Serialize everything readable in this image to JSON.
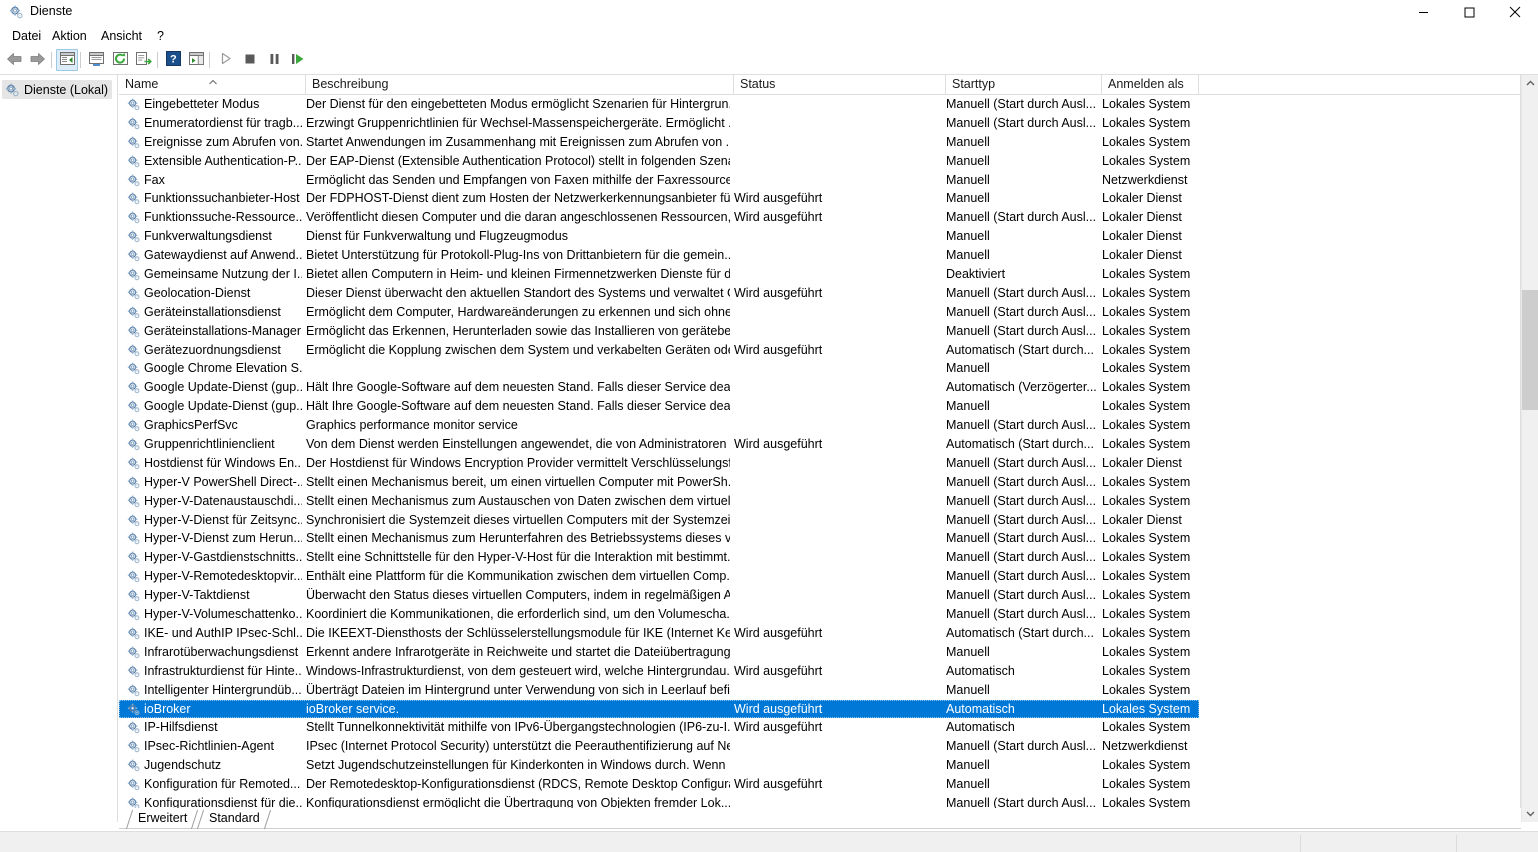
{
  "window": {
    "title": "Dienste",
    "icon": "services-gear-icon",
    "controls": {
      "minimize": "minimize-icon",
      "maximize": "maximize-icon",
      "close": "close-icon"
    }
  },
  "menubar": {
    "items": [
      {
        "label": "Datei"
      },
      {
        "label": "Aktion"
      },
      {
        "label": "Ansicht"
      },
      {
        "label": "?"
      }
    ]
  },
  "toolbar": {
    "buttons": [
      {
        "name": "back-button",
        "icon": "arrow-left-icon"
      },
      {
        "name": "forward-button",
        "icon": "arrow-right-icon"
      },
      {
        "name": "show-hide-console-tree-button",
        "icon": "console-tree-icon",
        "active": true
      },
      {
        "name": "properties-button",
        "icon": "properties-window-icon"
      },
      {
        "name": "refresh-button",
        "icon": "refresh-circular-arrow-icon"
      },
      {
        "name": "export-list-button",
        "icon": "export-list-icon"
      },
      {
        "name": "help-button",
        "icon": "help-question-icon"
      },
      {
        "name": "show-action-pane-button",
        "icon": "action-pane-icon"
      },
      {
        "name": "start-service-button",
        "icon": "play-triangle-icon"
      },
      {
        "name": "stop-service-button",
        "icon": "stop-square-icon"
      },
      {
        "name": "pause-service-button",
        "icon": "pause-bars-icon"
      },
      {
        "name": "restart-service-button",
        "icon": "restart-play-icon"
      }
    ]
  },
  "tree": {
    "root": {
      "label": "Dienste (Lokal)",
      "icon": "services-gear-icon",
      "selected": true
    }
  },
  "list": {
    "columns": [
      {
        "key": "name",
        "label": "Name",
        "sorted": "asc"
      },
      {
        "key": "description",
        "label": "Beschreibung"
      },
      {
        "key": "status",
        "label": "Status"
      },
      {
        "key": "starttype",
        "label": "Starttyp"
      },
      {
        "key": "logon",
        "label": "Anmelden als"
      }
    ],
    "rows": [
      {
        "name": "Eingebetteter Modus",
        "description": "Der Dienst für den eingebetteten Modus ermöglicht Szenarien für Hintergrun...",
        "status": "",
        "starttype": "Manuell (Start durch Ausl...",
        "logon": "Lokales System"
      },
      {
        "name": "Enumeratordienst für tragb...",
        "description": "Erzwingt Gruppenrichtlinien für Wechsel-Massenspeichergeräte. Ermöglicht ...",
        "status": "",
        "starttype": "Manuell (Start durch Ausl...",
        "logon": "Lokales System"
      },
      {
        "name": "Ereignisse zum Abrufen von...",
        "description": "Startet Anwendungen im Zusammenhang mit Ereignissen zum Abrufen von ...",
        "status": "",
        "starttype": "Manuell",
        "logon": "Lokales System"
      },
      {
        "name": "Extensible Authentication-P...",
        "description": "Der EAP-Dienst (Extensible Authentication Protocol) stellt in folgenden Szenar...",
        "status": "",
        "starttype": "Manuell",
        "logon": "Lokales System"
      },
      {
        "name": "Fax",
        "description": "Ermöglicht das Senden und Empfangen von Faxen mithilfe der Faxressourcen...",
        "status": "",
        "starttype": "Manuell",
        "logon": "Netzwerkdienst"
      },
      {
        "name": "Funktionssuchanbieter-Host",
        "description": "Der FDPHOST-Dienst dient zum Hosten der Netzwerkerkennungsanbieter für ...",
        "status": "Wird ausgeführt",
        "starttype": "Manuell",
        "logon": "Lokaler Dienst"
      },
      {
        "name": "Funktionssuche-Ressource...",
        "description": "Veröffentlicht diesen Computer und die daran angeschlossenen Ressourcen, ...",
        "status": "Wird ausgeführt",
        "starttype": "Manuell (Start durch Ausl...",
        "logon": "Lokaler Dienst"
      },
      {
        "name": "Funkverwaltungsdienst",
        "description": "Dienst für Funkverwaltung und Flugzeugmodus",
        "status": "",
        "starttype": "Manuell",
        "logon": "Lokaler Dienst"
      },
      {
        "name": "Gatewaydienst auf Anwend...",
        "description": "Bietet Unterstützung für Protokoll-Plug-Ins von Drittanbietern für die gemein...",
        "status": "",
        "starttype": "Manuell",
        "logon": "Lokaler Dienst"
      },
      {
        "name": "Gemeinsame Nutzung der I...",
        "description": "Bietet allen Computern in Heim- und kleinen Firmennetzwerken Dienste für d...",
        "status": "",
        "starttype": "Deaktiviert",
        "logon": "Lokales System"
      },
      {
        "name": "Geolocation-Dienst",
        "description": "Dieser Dienst überwacht den aktuellen Standort des Systems und verwaltet Ge...",
        "status": "Wird ausgeführt",
        "starttype": "Manuell (Start durch Ausl...",
        "logon": "Lokales System"
      },
      {
        "name": "Geräteinstallationsdienst",
        "description": "Ermöglicht dem Computer, Hardwareänderungen zu erkennen und sich ohne...",
        "status": "",
        "starttype": "Manuell (Start durch Ausl...",
        "logon": "Lokales System"
      },
      {
        "name": "Geräteinstallations-Manager",
        "description": "Ermöglicht das Erkennen, Herunterladen sowie das Installieren von gerätebez...",
        "status": "",
        "starttype": "Manuell (Start durch Ausl...",
        "logon": "Lokales System"
      },
      {
        "name": "Gerätezuordnungsdienst",
        "description": "Ermöglicht die Kopplung zwischen dem System und verkabelten Geräten ode...",
        "status": "Wird ausgeführt",
        "starttype": "Automatisch (Start durch...",
        "logon": "Lokales System"
      },
      {
        "name": "Google Chrome Elevation S...",
        "description": "",
        "status": "",
        "starttype": "Manuell",
        "logon": "Lokales System"
      },
      {
        "name": "Google Update-Dienst (gup...",
        "description": "Hält Ihre Google-Software auf dem neuesten Stand. Falls dieser Service deakti...",
        "status": "",
        "starttype": "Automatisch (Verzögerter...",
        "logon": "Lokales System"
      },
      {
        "name": "Google Update-Dienst (gup...",
        "description": "Hält Ihre Google-Software auf dem neuesten Stand. Falls dieser Service deakti...",
        "status": "",
        "starttype": "Manuell",
        "logon": "Lokales System"
      },
      {
        "name": "GraphicsPerfSvc",
        "description": "Graphics performance monitor service",
        "status": "",
        "starttype": "Manuell (Start durch Ausl...",
        "logon": "Lokales System"
      },
      {
        "name": "Gruppenrichtlinienclient",
        "description": "Von dem Dienst werden Einstellungen angewendet, die von Administratoren ...",
        "status": "Wird ausgeführt",
        "starttype": "Automatisch (Start durch...",
        "logon": "Lokales System"
      },
      {
        "name": "Hostdienst für Windows En...",
        "description": "Der Hostdienst für Windows Encryption Provider vermittelt Verschlüsselungsf...",
        "status": "",
        "starttype": "Manuell (Start durch Ausl...",
        "logon": "Lokaler Dienst"
      },
      {
        "name": "Hyper-V PowerShell Direct-...",
        "description": "Stellt einen Mechanismus bereit, um einen virtuellen Computer mit PowerSh...",
        "status": "",
        "starttype": "Manuell (Start durch Ausl...",
        "logon": "Lokales System"
      },
      {
        "name": "Hyper-V-Datenaustauschdi...",
        "description": "Stellt einen Mechanismus zum Austauschen von Daten zwischen dem virtuell...",
        "status": "",
        "starttype": "Manuell (Start durch Ausl...",
        "logon": "Lokales System"
      },
      {
        "name": "Hyper-V-Dienst für Zeitsync...",
        "description": "Synchronisiert die Systemzeit dieses virtuellen Computers mit der Systemzeit ...",
        "status": "",
        "starttype": "Manuell (Start durch Ausl...",
        "logon": "Lokaler Dienst"
      },
      {
        "name": "Hyper-V-Dienst zum Herun...",
        "description": "Stellt einen Mechanismus zum Herunterfahren des Betriebssystems dieses virt...",
        "status": "",
        "starttype": "Manuell (Start durch Ausl...",
        "logon": "Lokales System"
      },
      {
        "name": "Hyper-V-Gastdienstschnitts...",
        "description": "Stellt eine Schnittstelle für den Hyper-V-Host für die Interaktion mit bestimmt...",
        "status": "",
        "starttype": "Manuell (Start durch Ausl...",
        "logon": "Lokales System"
      },
      {
        "name": "Hyper-V-Remotedesktopvir...",
        "description": "Enthält eine Plattform für die Kommunikation zwischen dem virtuellen Comp...",
        "status": "",
        "starttype": "Manuell (Start durch Ausl...",
        "logon": "Lokales System"
      },
      {
        "name": "Hyper-V-Taktdienst",
        "description": "Überwacht den Status dieses virtuellen Computers, indem in regelmäßigen A...",
        "status": "",
        "starttype": "Manuell (Start durch Ausl...",
        "logon": "Lokales System"
      },
      {
        "name": "Hyper-V-Volumeschattenko...",
        "description": "Koordiniert die Kommunikationen, die erforderlich sind, um den Volumescha...",
        "status": "",
        "starttype": "Manuell (Start durch Ausl...",
        "logon": "Lokales System"
      },
      {
        "name": "IKE- und AuthIP IPsec-Schl...",
        "description": "Die IKEEXT-Diensthosts der Schlüsselerstellungsmodule für IKE (Internet Key E...",
        "status": "Wird ausgeführt",
        "starttype": "Automatisch (Start durch...",
        "logon": "Lokales System"
      },
      {
        "name": "Infrarotüberwachungsdienst",
        "description": "Erkennt andere Infrarotgeräte in Reichweite und startet die Dateiübertragungs...",
        "status": "",
        "starttype": "Manuell",
        "logon": "Lokales System"
      },
      {
        "name": "Infrastrukturdienst für Hinte...",
        "description": "Windows-Infrastrukturdienst, von dem gesteuert wird, welche Hintergrundau...",
        "status": "Wird ausgeführt",
        "starttype": "Automatisch",
        "logon": "Lokales System"
      },
      {
        "name": "Intelligenter Hintergrundüb...",
        "description": "Überträgt Dateien im Hintergrund unter Verwendung von sich in Leerlauf befi...",
        "status": "",
        "starttype": "Manuell",
        "logon": "Lokales System"
      },
      {
        "name": "ioBroker",
        "description": "ioBroker service.",
        "status": "Wird ausgeführt",
        "starttype": "Automatisch",
        "logon": "Lokales System",
        "selected": true
      },
      {
        "name": "IP-Hilfsdienst",
        "description": "Stellt Tunnelkonnektivität mithilfe von IPv6-Übergangstechnologien (IP6-zu-I...",
        "status": "Wird ausgeführt",
        "starttype": "Automatisch",
        "logon": "Lokales System"
      },
      {
        "name": "IPsec-Richtlinien-Agent",
        "description": "IPsec (Internet Protocol Security) unterstützt die Peerauthentifizierung auf Ne...",
        "status": "",
        "starttype": "Manuell (Start durch Ausl...",
        "logon": "Netzwerkdienst"
      },
      {
        "name": "Jugendschutz",
        "description": "Setzt Jugendschutzeinstellungen für Kinderkonten in Windows durch. Wenn ...",
        "status": "",
        "starttype": "Manuell",
        "logon": "Lokales System"
      },
      {
        "name": "Konfiguration für Remoted...",
        "description": "Der Remotedesktop-Konfigurationsdienst (RDCS, Remote Desktop Configurat...",
        "status": "Wird ausgeführt",
        "starttype": "Manuell",
        "logon": "Lokales System"
      },
      {
        "name": "Konfigurationsdienst für die...",
        "description": "Konfigurationsdienst ermöglicht die Übertragung von Objekten fremder Lok...",
        "status": "",
        "starttype": "Manuell (Start durch Ausl...",
        "logon": "Lokales System"
      }
    ]
  },
  "tabs": [
    {
      "label": "Erweitert",
      "selected": true
    },
    {
      "label": "Standard",
      "selected": false
    }
  ],
  "colors": {
    "selection": "#0078d7",
    "selection_text": "#ffffff",
    "border": "#dededd",
    "toolbar_active": "#dcedf9",
    "status_bar": "#f0f0f0",
    "scroll_thumb": "#cdcdcd",
    "tree_selection": "#e5e5e5"
  }
}
